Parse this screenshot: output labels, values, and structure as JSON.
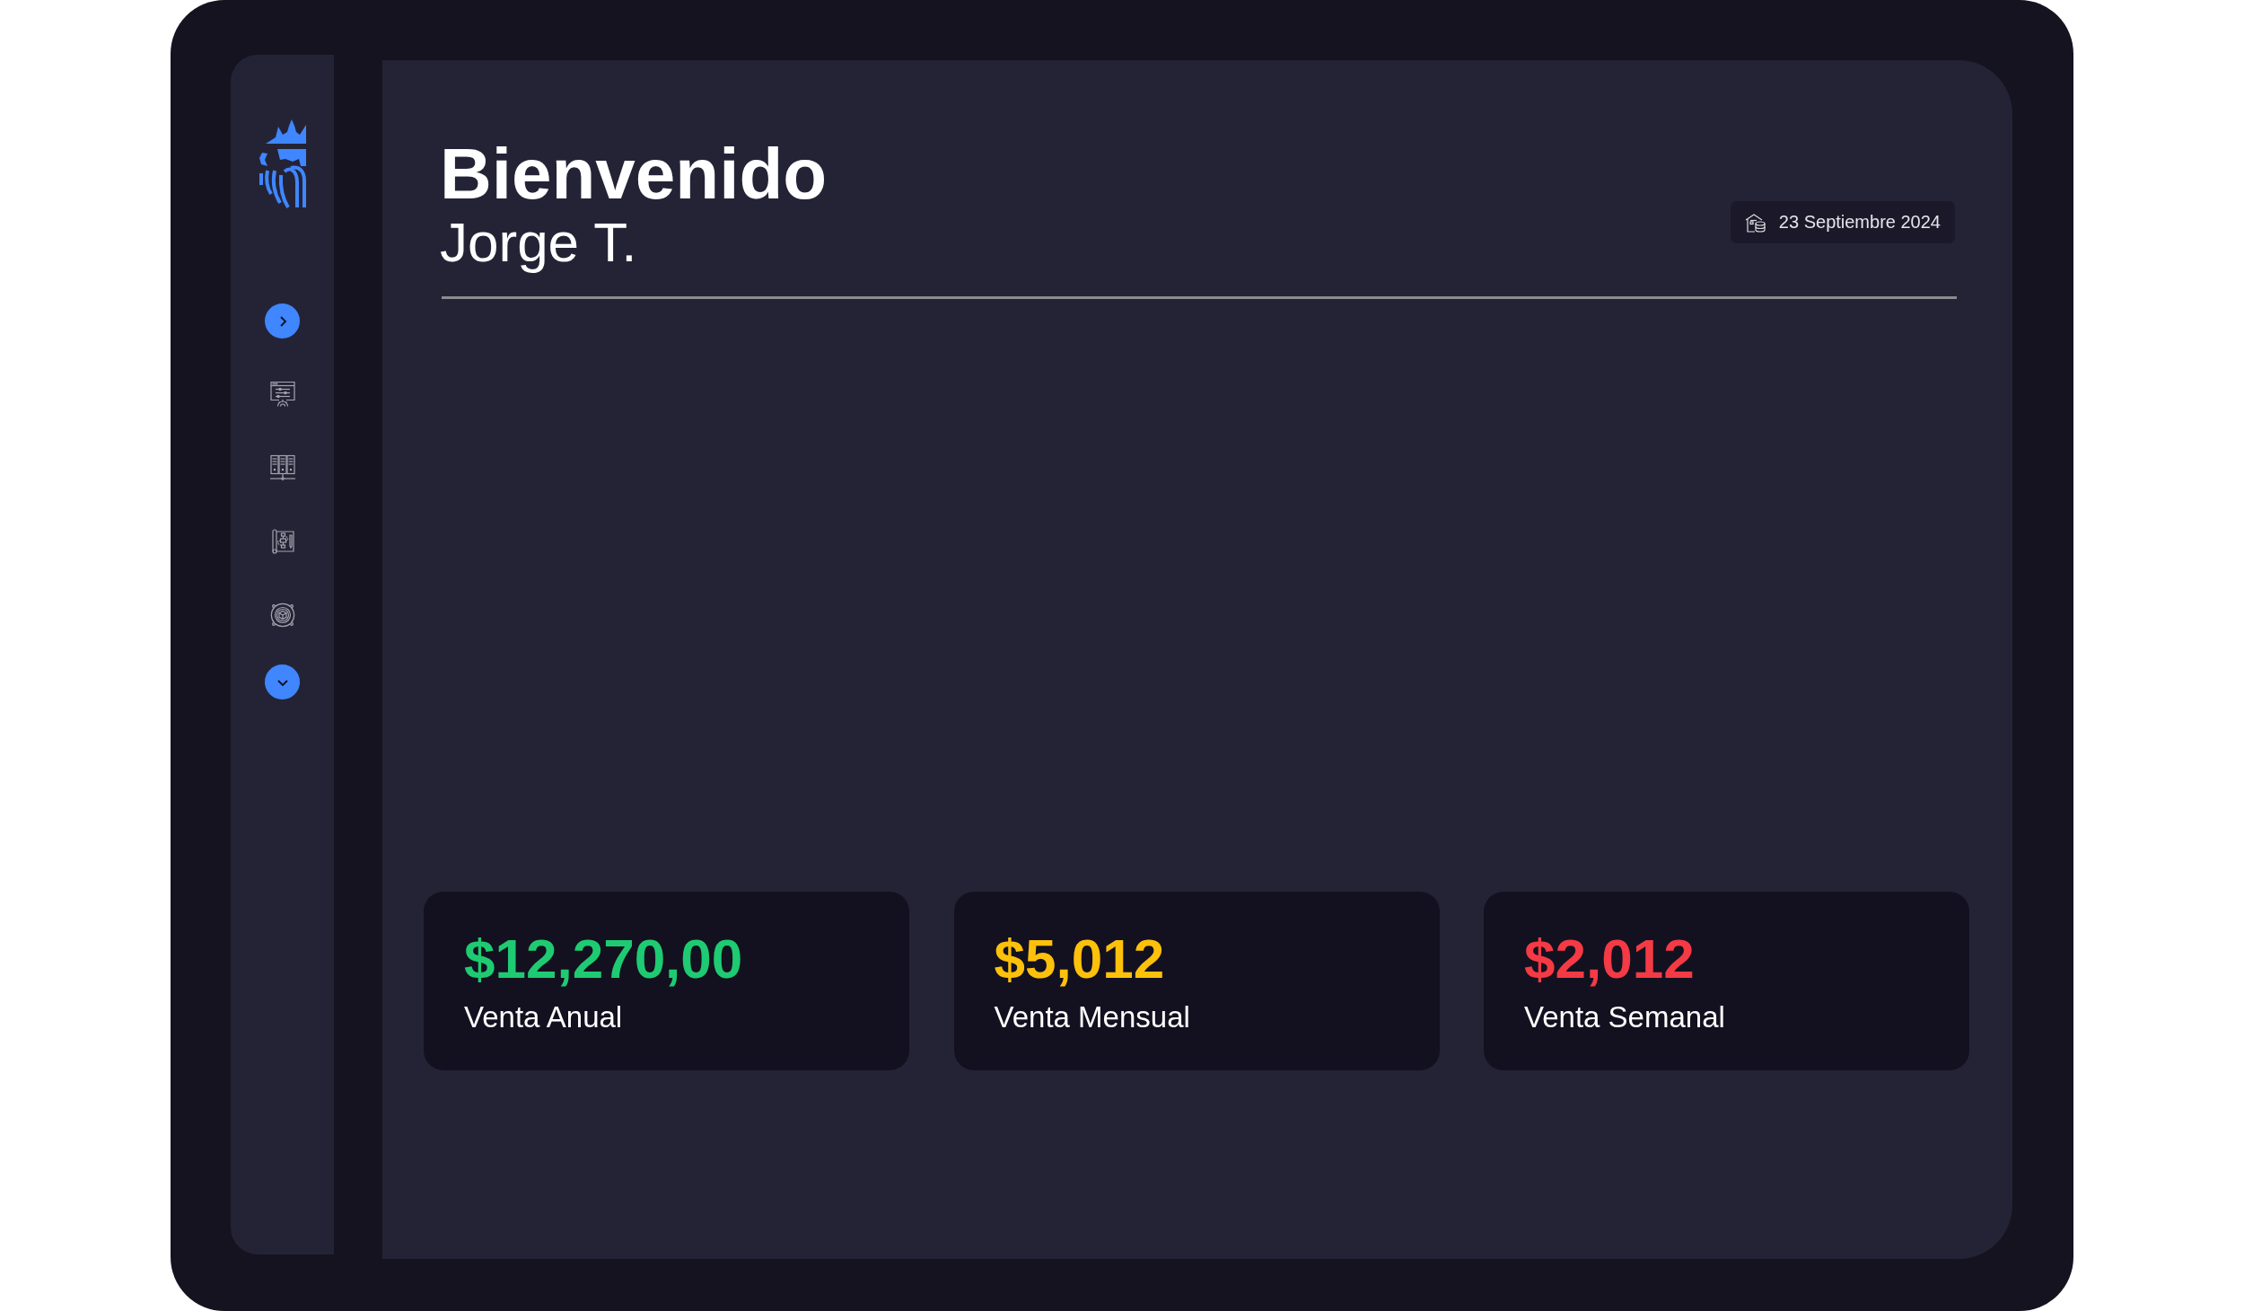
{
  "header": {
    "greeting": "Bienvenido",
    "user_name": "Jorge T.",
    "date": "23 Septiembre 2024"
  },
  "stats": [
    {
      "value": "$12,270,00",
      "label": "Venta Anual",
      "color": "#1ecb72"
    },
    {
      "value": "$5,012",
      "label": "Venta Mensual",
      "color": "#fdc10c"
    },
    {
      "value": "$2,012",
      "label": "Venta Semanal",
      "color": "#f43a45"
    }
  ]
}
